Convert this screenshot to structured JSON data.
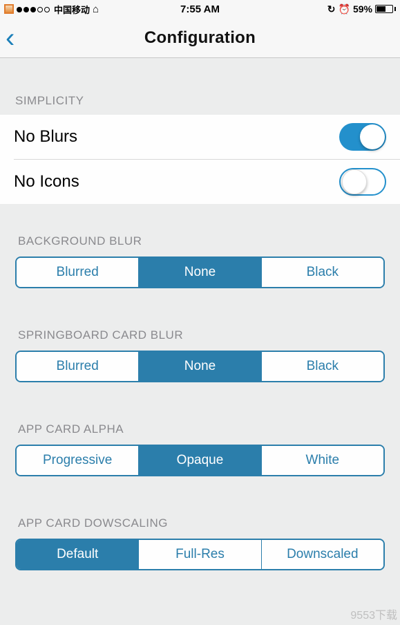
{
  "statusbar": {
    "carrier": "中国移动",
    "time": "7:55 AM",
    "battery_pct": "59%"
  },
  "nav": {
    "title": "Configuration"
  },
  "sections": {
    "simplicity": {
      "header": "SIMPLICITY",
      "rows": {
        "no_blurs": {
          "label": "No Blurs",
          "on": true
        },
        "no_icons": {
          "label": "No Icons",
          "on": false
        }
      }
    },
    "background_blur": {
      "header": "BACKGROUND BLUR",
      "options": [
        "Blurred",
        "None",
        "Black"
      ],
      "selected": 1
    },
    "springboard_blur": {
      "header": "SPRINGBOARD CARD BLUR",
      "options": [
        "Blurred",
        "None",
        "Black"
      ],
      "selected": 1
    },
    "app_card_alpha": {
      "header": "APP CARD ALPHA",
      "options": [
        "Progressive",
        "Opaque",
        "White"
      ],
      "selected": 1
    },
    "app_card_downscaling": {
      "header": "APP CARD DOWSCALING",
      "options": [
        "Default",
        "Full-Res",
        "Downscaled"
      ],
      "selected": 0
    }
  },
  "watermark": "9553下载"
}
